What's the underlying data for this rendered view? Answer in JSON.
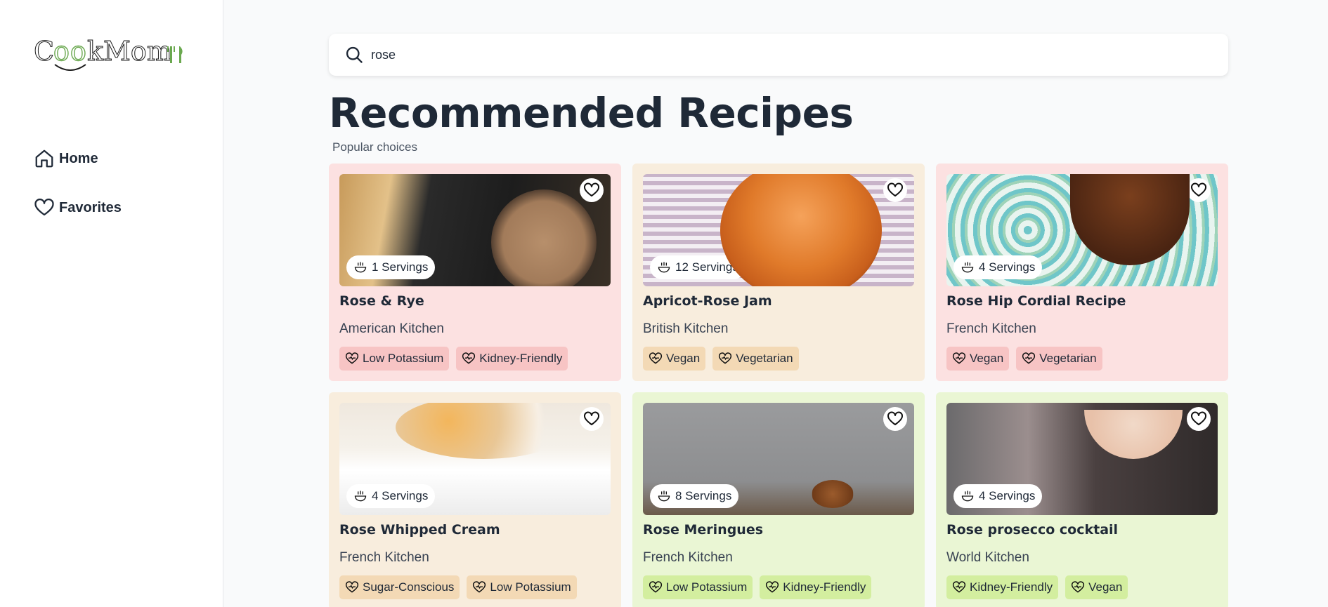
{
  "app": {
    "logo_alt": "CookMom"
  },
  "sidebar": {
    "items": [
      {
        "label": "Home",
        "icon": "home-icon"
      },
      {
        "label": "Favorites",
        "icon": "heart-icon"
      }
    ]
  },
  "search": {
    "value": "rose",
    "placeholder": ""
  },
  "main": {
    "title": "Recommended Recipes",
    "subtitle": "Popular choices"
  },
  "recipes": [
    {
      "name": "Rose & Rye",
      "kitchen": "American Kitchen",
      "servings": "1 Servings",
      "tags": [
        "Low Potassium",
        "Kidney-Friendly"
      ],
      "theme": "pink"
    },
    {
      "name": "Apricot-Rose Jam",
      "kitchen": "British Kitchen",
      "servings": "12 Servings",
      "tags": [
        "Vegan",
        "Vegetarian"
      ],
      "theme": "beige"
    },
    {
      "name": "Rose Hip Cordial Recipe",
      "kitchen": "French Kitchen",
      "servings": "4 Servings",
      "tags": [
        "Vegan",
        "Vegetarian"
      ],
      "theme": "pink"
    },
    {
      "name": "Rose Whipped Cream",
      "kitchen": "French Kitchen",
      "servings": "4 Servings",
      "tags": [
        "Sugar-Conscious",
        "Low Potassium"
      ],
      "theme": "beige"
    },
    {
      "name": "Rose Meringues",
      "kitchen": "French Kitchen",
      "servings": "8 Servings",
      "tags": [
        "Low Potassium",
        "Kidney-Friendly"
      ],
      "theme": "green"
    },
    {
      "name": "Rose prosecco cocktail",
      "kitchen": "World Kitchen",
      "servings": "4 Servings",
      "tags": [
        "Kidney-Friendly",
        "Vegan"
      ],
      "theme": "green"
    }
  ],
  "colors": {
    "pink": "#fce1e1",
    "beige": "#f8eddd",
    "green": "#eaf6d4",
    "logo_green": "#6aa84f"
  }
}
